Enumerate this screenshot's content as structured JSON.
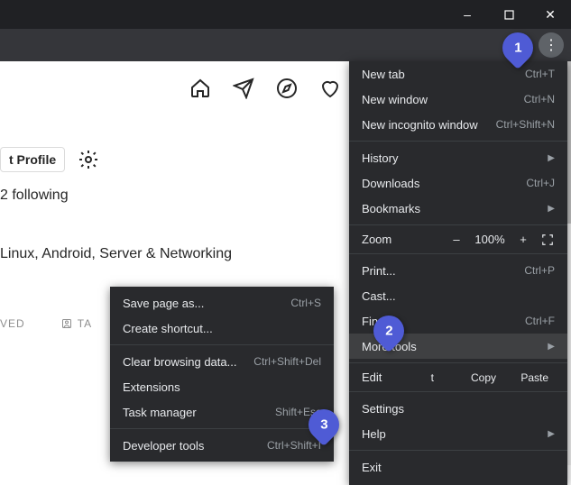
{
  "window": {
    "minimize": "–",
    "maximize": "☐",
    "close": "✕"
  },
  "page": {
    "edit_profile": "t Profile",
    "following": "2 following",
    "bio": "Linux, Android, Server & Networking",
    "tab_saved": "VED",
    "tab_tagged": "TA"
  },
  "main_menu": [
    {
      "type": "item",
      "label": "New tab",
      "shortcut": "Ctrl+T"
    },
    {
      "type": "item",
      "label": "New window",
      "shortcut": "Ctrl+N"
    },
    {
      "type": "item",
      "label": "New incognito window",
      "shortcut": "Ctrl+Shift+N"
    },
    {
      "type": "sep"
    },
    {
      "type": "item",
      "label": "History",
      "arrow": true
    },
    {
      "type": "item",
      "label": "Downloads",
      "shortcut": "Ctrl+J"
    },
    {
      "type": "item",
      "label": "Bookmarks",
      "arrow": true
    },
    {
      "type": "sep"
    },
    {
      "type": "zoom",
      "label": "Zoom",
      "minus": "–",
      "value": "100%",
      "plus": "+"
    },
    {
      "type": "sep"
    },
    {
      "type": "item",
      "label": "Print...",
      "shortcut": "Ctrl+P"
    },
    {
      "type": "item",
      "label": "Cast..."
    },
    {
      "type": "item",
      "label": "Find...",
      "shortcut": "Ctrl+F"
    },
    {
      "type": "item",
      "label": "More tools",
      "arrow": true,
      "hover": true
    },
    {
      "type": "sep"
    },
    {
      "type": "edit",
      "label": "Edit",
      "b1": "t",
      "b2": "Copy",
      "b3": "Paste"
    },
    {
      "type": "sep"
    },
    {
      "type": "item",
      "label": "Settings"
    },
    {
      "type": "item",
      "label": "Help",
      "arrow": true
    },
    {
      "type": "sep"
    },
    {
      "type": "item",
      "label": "Exit"
    }
  ],
  "sub_menu": [
    {
      "type": "item",
      "label": "Save page as...",
      "shortcut": "Ctrl+S"
    },
    {
      "type": "item",
      "label": "Create shortcut..."
    },
    {
      "type": "sep"
    },
    {
      "type": "item",
      "label": "Clear browsing data...",
      "shortcut": "Ctrl+Shift+Del"
    },
    {
      "type": "item",
      "label": "Extensions"
    },
    {
      "type": "item",
      "label": "Task manager",
      "shortcut": "Shift+Esc"
    },
    {
      "type": "sep"
    },
    {
      "type": "item",
      "label": "Developer tools",
      "shortcut": "Ctrl+Shift+I"
    }
  ],
  "badges": {
    "b1": "1",
    "b2": "2",
    "b3": "3"
  }
}
